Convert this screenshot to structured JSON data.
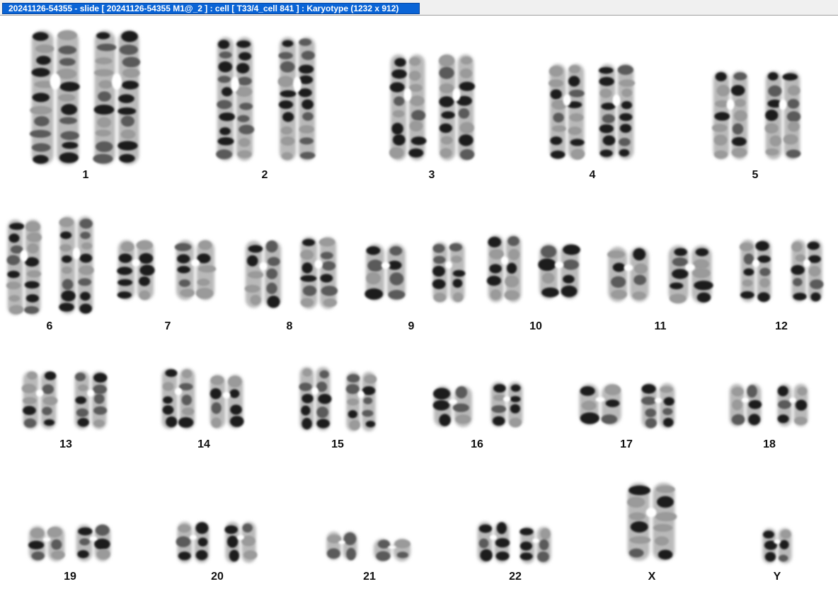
{
  "window": {
    "title": "20241126-54355 - slide [ 20241126-54355 M1@_2 ] : cell [ T33/4_cell 841 ] : Karyotype  (1232 x 912)"
  },
  "karyotype": {
    "chromosomes": [
      "1",
      "2",
      "3",
      "4",
      "5",
      "6",
      "7",
      "8",
      "9",
      "10",
      "11",
      "12",
      "13",
      "14",
      "15",
      "16",
      "17",
      "18",
      "19",
      "20",
      "21",
      "22",
      "X",
      "Y"
    ]
  }
}
